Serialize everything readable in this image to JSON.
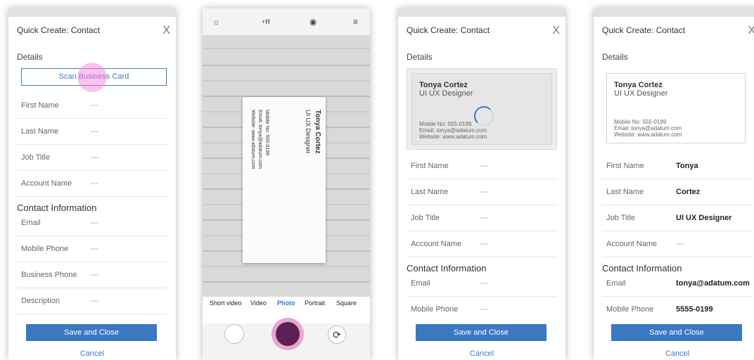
{
  "form": {
    "title": "Quick Create: Contact",
    "close_symbol": "X",
    "details_section": "Details",
    "scan_button": "Scan Business Card",
    "contact_section": "Contact Information",
    "save_label": "Save and Close",
    "cancel_label": "Cancel",
    "empty_value": "---"
  },
  "screen1": {
    "fields": [
      {
        "label": "First Name",
        "value": "---"
      },
      {
        "label": "Last Name",
        "value": "---"
      },
      {
        "label": "Job Title",
        "value": "---"
      },
      {
        "label": "Account Name",
        "value": "---"
      }
    ],
    "contact_fields": [
      {
        "label": "Email",
        "value": "---"
      },
      {
        "label": "Mobile Phone",
        "value": "---"
      },
      {
        "label": "Business Phone",
        "value": "---"
      },
      {
        "label": "Description",
        "value": "---"
      }
    ]
  },
  "camera": {
    "modes": [
      "Short video",
      "Video",
      "Photo",
      "Portrait",
      "Square"
    ],
    "active_mode": "Photo",
    "icons": [
      "settings-icon",
      "hdr-icon",
      "live-icon",
      "menu-icon",
      "shutter-icon",
      "switch-camera-icon"
    ]
  },
  "business_card": {
    "name": "Tonya Cortez",
    "role": "UI UX Designer",
    "mobile": "Mobile No: 555-0199",
    "email": "Email: tonya@adatum.com",
    "website": "Website: www.adatum.com"
  },
  "screen3": {
    "fields": [
      {
        "label": "First Name",
        "value": "---"
      },
      {
        "label": "Last Name",
        "value": "---"
      },
      {
        "label": "Job Title",
        "value": "---"
      },
      {
        "label": "Account Name",
        "value": "---"
      }
    ],
    "contact_fields": [
      {
        "label": "Email",
        "value": "---"
      },
      {
        "label": "Mobile Phone",
        "value": "---"
      }
    ]
  },
  "screen4": {
    "fields": [
      {
        "label": "First Name",
        "value": "Tonya"
      },
      {
        "label": "Last Name",
        "value": "Cortez"
      },
      {
        "label": "Job Title",
        "value": "UI UX Designer"
      },
      {
        "label": "Account Name",
        "value": "---"
      }
    ],
    "contact_fields": [
      {
        "label": "Email",
        "value": "tonya@adatum.com"
      },
      {
        "label": "Mobile Phone",
        "value": "5555-0199"
      }
    ]
  },
  "colors": {
    "accent": "#3a78c2",
    "shutter": "#5d1f54",
    "active_mode": "#2a7ad1"
  }
}
